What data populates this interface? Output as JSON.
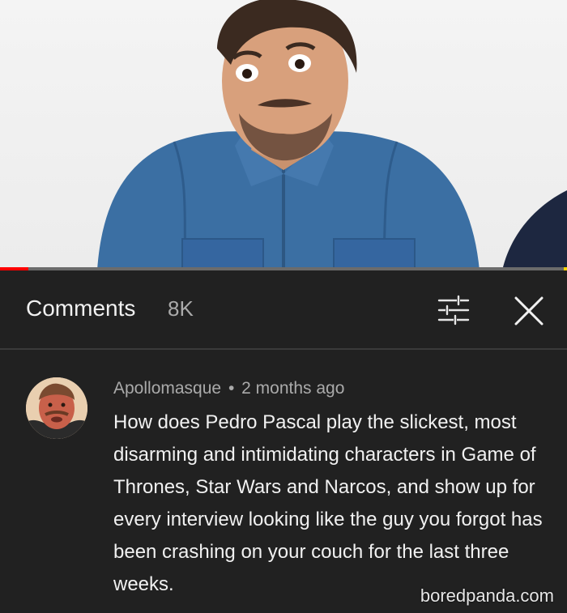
{
  "video": {
    "progress_fraction": 0.05,
    "colors": {
      "progress": "#ff0000",
      "track": "#6b6b6b"
    }
  },
  "comments_header": {
    "title": "Comments",
    "count": "8K",
    "icons": {
      "filter": "sort-filter-icon",
      "close": "close-icon"
    }
  },
  "comment": {
    "author": "Apollomasque",
    "separator": "•",
    "time": "2 months ago",
    "text": "How does Pedro Pascal play the slickest, most disarming and intimidating characters in Game of Thrones, Star Wars and Narcos, and show up for every interview looking like the guy you forgot has been crashing on your couch for the last three weeks."
  },
  "watermark": "boredpanda.com"
}
